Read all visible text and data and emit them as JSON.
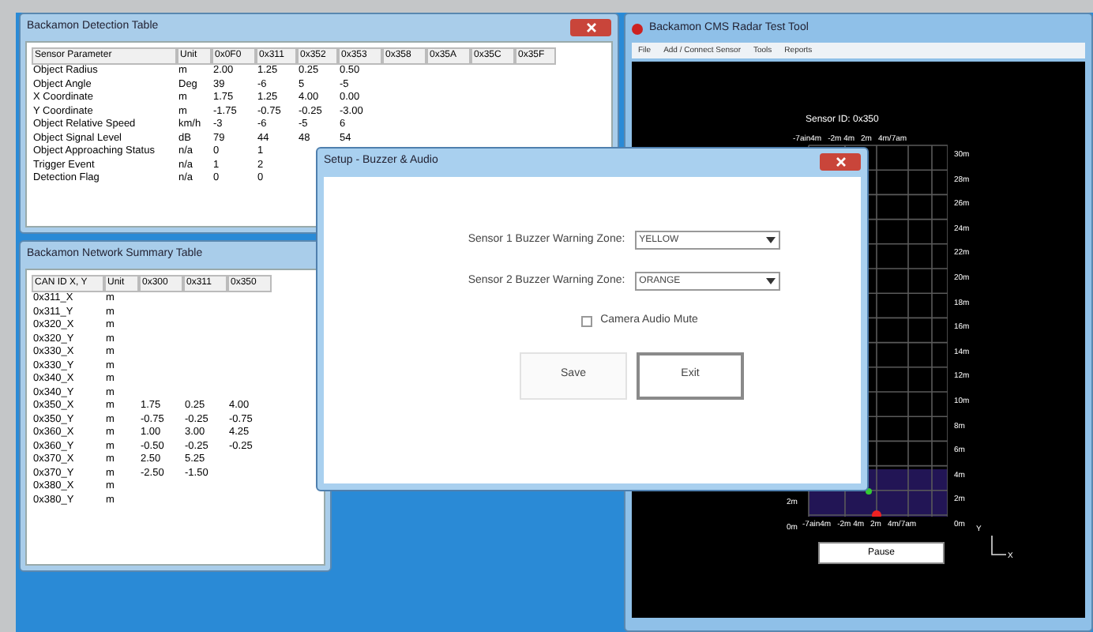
{
  "detection_window": {
    "title": "Backamon Detection Table",
    "columns": [
      "Sensor Parameter",
      "Unit",
      "0x0F0",
      "0x311",
      "0x352",
      "0x353",
      "0x358",
      "0x35A",
      "0x35C",
      "0x35F"
    ],
    "rows": [
      [
        "Object Radius",
        "m",
        "2.00",
        "1.25",
        "0.25",
        "0.50"
      ],
      [
        "Object Angle",
        "Deg",
        "39",
        "-6",
        "5",
        "-5"
      ],
      [
        "X Coordinate",
        "m",
        "1.75",
        "1.25",
        "4.00",
        "0.00"
      ],
      [
        "Y Coordinate",
        "m",
        "-1.75",
        "-0.75",
        "-0.25",
        "-3.00"
      ],
      [
        "Object Relative Speed",
        "km/h",
        "-3",
        "-6",
        "-5",
        "6"
      ],
      [
        "Object Signal Level",
        "dB",
        "79",
        "44",
        "48",
        "54"
      ],
      [
        "Object Approaching Status",
        "n/a",
        "0",
        "1"
      ],
      [
        "Trigger Event",
        "n/a",
        "1",
        "2"
      ],
      [
        "Detection Flag",
        "n/a",
        "0",
        "0"
      ]
    ]
  },
  "summary_window": {
    "title": "Backamon Network Summary Table",
    "columns": [
      "CAN ID X, Y",
      "Unit",
      "0x300",
      "0x311",
      "0x350"
    ],
    "rows": [
      [
        "0x311_X",
        "m"
      ],
      [
        "0x311_Y",
        "m"
      ],
      [
        "0x320_X",
        "m"
      ],
      [
        "0x320_Y",
        "m"
      ],
      [
        "0x330_X",
        "m"
      ],
      [
        "0x330_Y",
        "m"
      ],
      [
        "0x340_X",
        "m"
      ],
      [
        "0x340_Y",
        "m"
      ],
      [
        "0x350_X",
        "m",
        "1.75",
        "0.25",
        "4.00"
      ],
      [
        "0x350_Y",
        "m",
        "-0.75",
        "-0.25",
        "-0.75"
      ],
      [
        "0x360_X",
        "m",
        "1.00",
        "3.00",
        "4.25"
      ],
      [
        "0x360_Y",
        "m",
        "-0.50",
        "-0.25",
        "-0.25"
      ],
      [
        "0x370_X",
        "m",
        "2.50",
        "5.25"
      ],
      [
        "0x370_Y",
        "m",
        "-2.50",
        "-1.50"
      ],
      [
        "0x380_X",
        "m"
      ],
      [
        "0x380_Y",
        "m"
      ]
    ]
  },
  "radar_window": {
    "title": "Backamon CMS Radar Test Tool",
    "menu": [
      "File",
      "Add / Connect Sensor",
      "Tools",
      "Reports"
    ],
    "sensor_label": "Sensor ID: 0x350",
    "top_labels": [
      "-7ain4m",
      "-2m 4m",
      "2m",
      "4m/7am"
    ],
    "range_labels": [
      "30m",
      "28m",
      "26m",
      "24m",
      "22m",
      "20m",
      "18m",
      "16m",
      "14m",
      "12m",
      "10m",
      "8m",
      "6m",
      "4m",
      "2m",
      "0m"
    ],
    "left_labels": [
      "2m",
      "0m"
    ],
    "bottom_labels": [
      "-7ain4m",
      "-2m 4m",
      "2m",
      "4m/7am"
    ],
    "pause_button": "Pause",
    "axis_labels": [
      "Y",
      "X"
    ]
  },
  "dialog": {
    "title": "Setup - Buzzer & Audio",
    "fields": [
      {
        "label": "Sensor 1 Buzzer Warning Zone:",
        "value": "YELLOW"
      },
      {
        "label": "Sensor 2 Buzzer Warning Zone:",
        "value": "ORANGE"
      }
    ],
    "checkbox": {
      "label": "Camera Audio Mute",
      "checked": false
    },
    "buttons": [
      {
        "label": "Save",
        "focused": false
      },
      {
        "label": "Exit",
        "focused": true
      }
    ]
  }
}
